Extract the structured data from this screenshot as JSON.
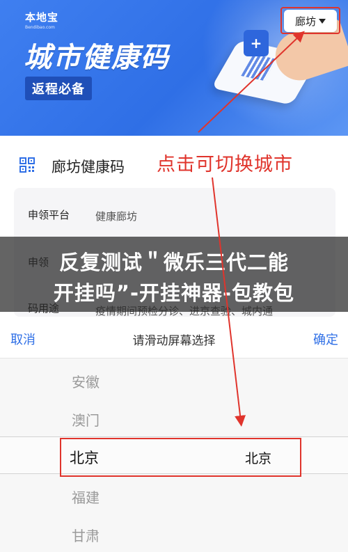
{
  "banner": {
    "logo_text": "本地宝",
    "logo_sub": "Bendibao.com",
    "title": "城市健康码",
    "subtitle": "返程必备",
    "city_selector": "廊坊"
  },
  "card": {
    "title": "廊坊健康码",
    "annotation": "点击可切换城市",
    "rows": [
      {
        "label": "申领平台",
        "value": "健康廊坊"
      },
      {
        "label": "申领",
        "value": ""
      },
      {
        "label": "码用途",
        "value": "疫情期间预检分诊、进京查验、城内通"
      }
    ]
  },
  "overlay": {
    "line1": "反复测试＂微乐三代二能",
    "line2": "开挂吗”-开挂神器-包教包"
  },
  "picker": {
    "cancel": "取消",
    "title": "请滑动屏幕选择",
    "confirm": "确定",
    "options_above": [
      "安徽",
      "澳门"
    ],
    "selected_province": "北京",
    "selected_city": "北京",
    "options_below": [
      "福建",
      "甘肃"
    ]
  },
  "colors": {
    "accent": "#2f6fe6",
    "annotation_red": "#e0342c"
  },
  "icons": {
    "qr": "qr-code-icon",
    "dropdown": "caret-down-icon"
  }
}
